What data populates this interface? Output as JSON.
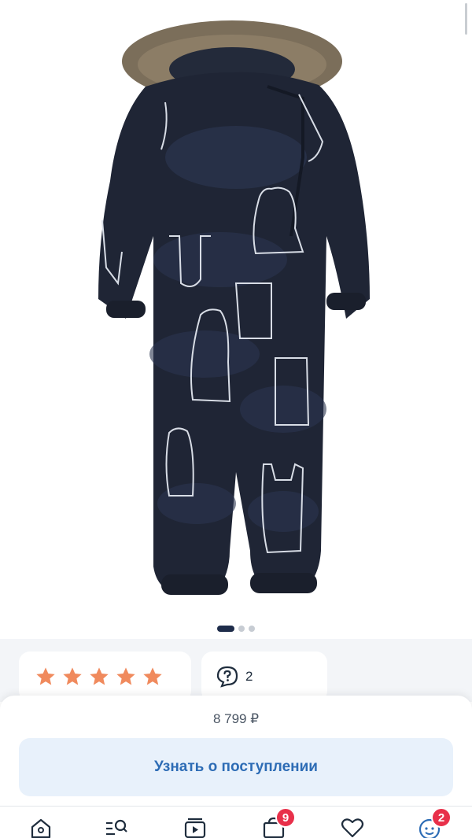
{
  "product": {
    "image_alt": "Детский зимний комбинезон",
    "gallery": {
      "total": 3,
      "active": 1
    }
  },
  "rating": {
    "stars": 5,
    "star_color": "#f08a5d"
  },
  "reviews": {
    "count": "2"
  },
  "price": {
    "text": "8 799 ₽"
  },
  "cta": {
    "label": "Узнать о поступлении"
  },
  "tabbar": {
    "items": [
      {
        "icon": "home-icon"
      },
      {
        "icon": "catalog-search-icon"
      },
      {
        "icon": "video-icon"
      },
      {
        "icon": "cart-icon",
        "badge": "9"
      },
      {
        "icon": "heart-icon"
      },
      {
        "icon": "profile-icon",
        "badge": "2"
      }
    ]
  },
  "colors": {
    "accent": "#2d6cb5",
    "cta_bg": "#e8f1fb",
    "badge": "#e8304a",
    "dark": "#1e2c4a"
  }
}
